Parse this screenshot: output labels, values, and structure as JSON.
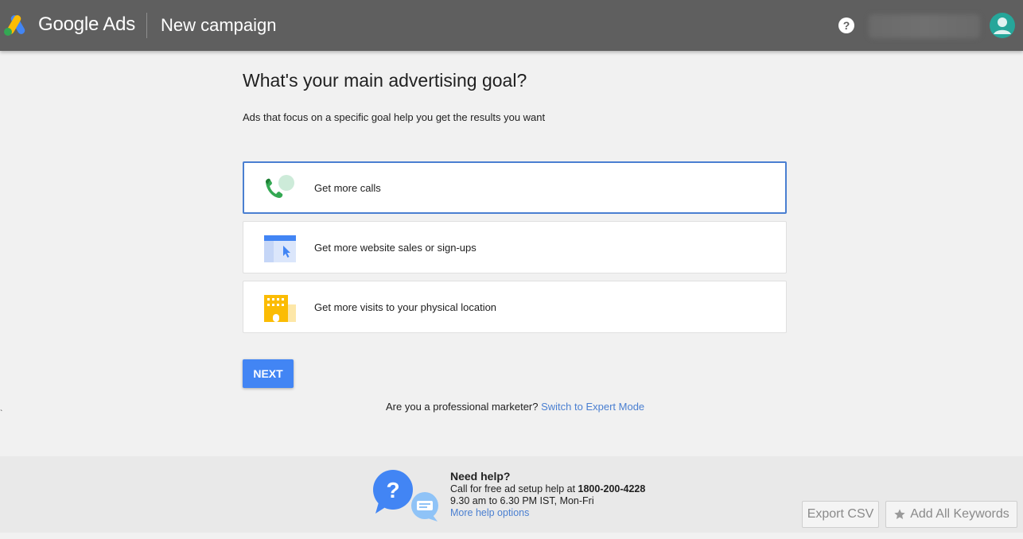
{
  "header": {
    "brand": "Google Ads",
    "page_title": "New campaign",
    "icons": {
      "logo": "google-ads-logo-icon",
      "help": "help-circle-icon",
      "avatar": "account-avatar-icon"
    }
  },
  "main": {
    "heading": "What's your main advertising goal?",
    "subheading": "Ads that focus on a specific goal help you get the results you want",
    "goals": [
      {
        "label": "Get more calls",
        "icon": "phone-call-icon",
        "selected": true
      },
      {
        "label": "Get more website sales or sign-ups",
        "icon": "website-icon",
        "selected": false
      },
      {
        "label": "Get more visits to your physical location",
        "icon": "storefront-icon",
        "selected": false
      }
    ],
    "next_label": "NEXT",
    "expert_prompt": "Are you a professional marketer?",
    "expert_link": "Switch to Expert Mode",
    "stray_mark": "`"
  },
  "footer": {
    "need_help": "Need help?",
    "call_text": "Call for free ad setup help at",
    "phone": "1800-200-4228",
    "hours": "9.30 am to 6.30 PM IST, Mon-Fri",
    "more_help": "More help options",
    "export_csv": "Export CSV",
    "add_all_keywords": "Add All Keywords"
  },
  "colors": {
    "header_bg": "#5f5f5f",
    "page_bg": "#f1f1f1",
    "accent_blue": "#4285f4",
    "link_blue": "#4a7fd1",
    "selected_border": "#4a7fd1"
  }
}
